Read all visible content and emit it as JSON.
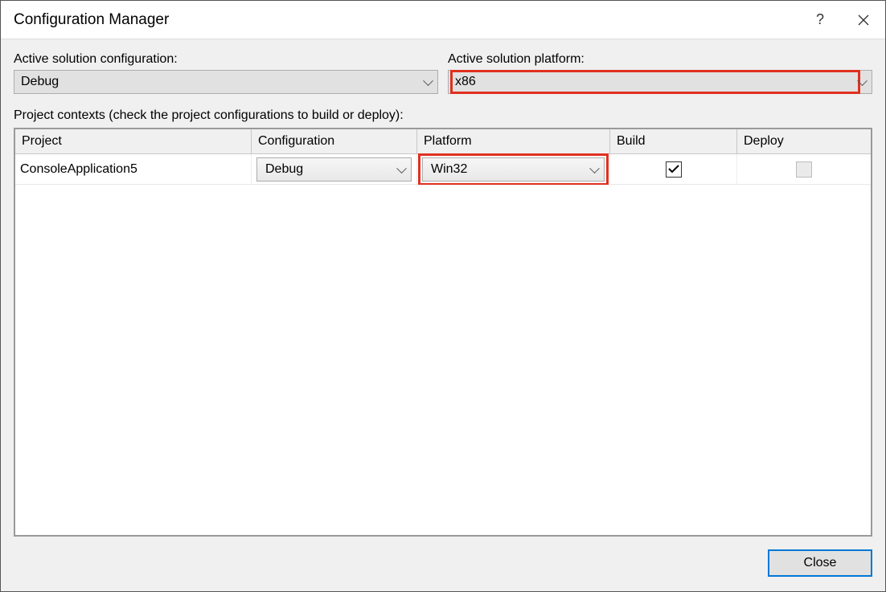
{
  "window_title": "Configuration Manager",
  "labels": {
    "active_config": "Active solution configuration:",
    "active_platform": "Active solution platform:",
    "contexts": "Project contexts (check the project configurations to build or deploy):"
  },
  "active_solution_configuration": "Debug",
  "active_solution_platform": "x86",
  "columns": {
    "project": "Project",
    "configuration": "Configuration",
    "platform": "Platform",
    "build": "Build",
    "deploy": "Deploy"
  },
  "rows": [
    {
      "project": "ConsoleApplication5",
      "configuration": "Debug",
      "platform": "Win32",
      "build": true,
      "deploy_enabled": false,
      "deploy": false
    }
  ],
  "buttons": {
    "close": "Close"
  }
}
